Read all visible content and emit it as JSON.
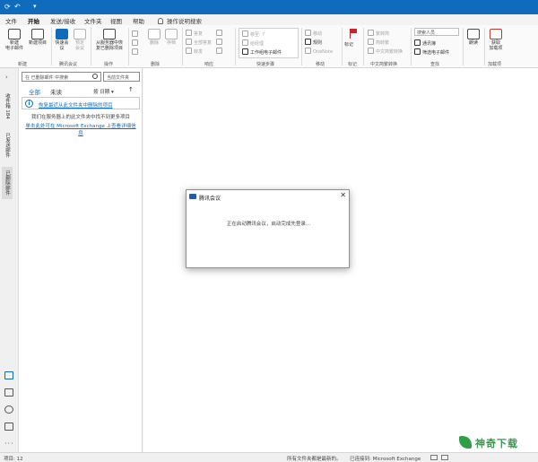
{
  "titlebar": {
    "icons": [
      "⟳",
      "↶",
      "▾"
    ]
  },
  "tabs": [
    "文件",
    "开始",
    "发送/接收",
    "文件夹",
    "视图",
    "帮助"
  ],
  "tellme": "操作说明搜索",
  "ribbon": {
    "new_email": "新建\n电子邮件",
    "new_items": "新建项目",
    "tencent_meeting": "快速会\n议",
    "schedule_meeting": "预定\n会议",
    "recover_deleted": "从服务器中恢\n复已删除项目",
    "groups": {
      "new": "新建",
      "tencent": "腾讯会议",
      "actions": "操作",
      "delete": "删除",
      "respond": "响应",
      "quicksteps": "快速步骤",
      "move": "移动",
      "tags": "标记",
      "cn_conversion": "中文简繁转换",
      "find": "查找",
      "addins": "加载项"
    },
    "delete_items": [
      "删除",
      "存档"
    ],
    "respond_items": [
      "答复",
      "全部答复",
      "转发"
    ],
    "quicksteps_items": [
      "移至: ?",
      "给经理",
      "工作组电子邮件"
    ],
    "move_items": [
      "移动",
      "规则",
      "OneNote"
    ],
    "tag_label": "标记",
    "cn_items": [
      "繁转简",
      "简转繁",
      "中文简繁转换"
    ],
    "people_search": "搜索人员",
    "address_book": "通讯簿",
    "filter_email": "筛选电子邮件",
    "read_aloud": "朗读",
    "get_addins": "获取\n加载项"
  },
  "rail": {
    "labels": [
      "收件箱 184",
      "已发送邮件",
      "已删除邮件"
    ]
  },
  "pane": {
    "search_placeholder": "在 已删除邮件 中搜索",
    "scope": "当前文件夹",
    "tab_all": "全部",
    "tab_unread": "未读",
    "sort_label": "按 日期",
    "info_link": "恢复最近从此文件夹中删除的项目",
    "msg_none": "我们在服务器上的此文件夹中找不到更多项目",
    "msg_link": "单击此处可在 Microsoft Exchange 上查看详细信息"
  },
  "dialog": {
    "title": "腾讯会议",
    "close": "✕",
    "message": "正在启动腾讯会议，启动完成先登录..."
  },
  "statusbar": {
    "items": "项目: 12",
    "uptodate": "所有文件夹都是最新的。",
    "connected": "已连接到: Microsoft Exchange"
  },
  "watermark": "神奇下载"
}
